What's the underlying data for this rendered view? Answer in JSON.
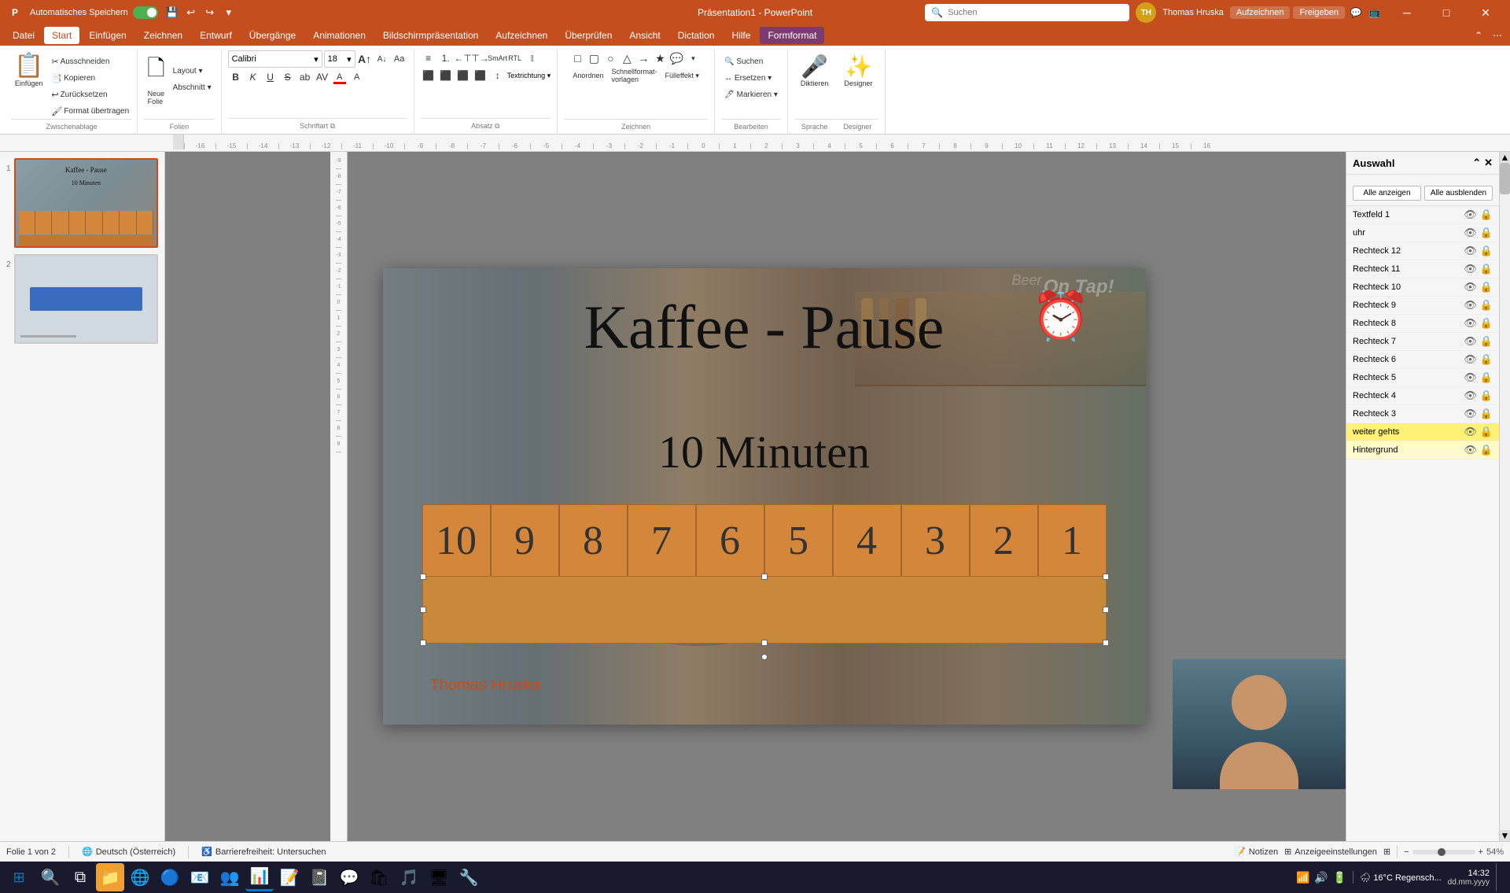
{
  "titlebar": {
    "autosave_label": "Automatisches Speichern",
    "app_name": "Präsentation1 - PowerPoint",
    "search_placeholder": "Suchen",
    "user_name": "Thomas Hruska",
    "user_initials": "TH",
    "save_icon": "💾",
    "undo_icon": "↩",
    "redo_icon": "↪",
    "record_label": "Aufzeichnen",
    "share_label": "Freigeben"
  },
  "menubar": {
    "items": [
      {
        "id": "datei",
        "label": "Datei"
      },
      {
        "id": "start",
        "label": "Start",
        "active": true
      },
      {
        "id": "einfugen",
        "label": "Einfügen"
      },
      {
        "id": "zeichnen",
        "label": "Zeichnen"
      },
      {
        "id": "entwurf",
        "label": "Entwurf"
      },
      {
        "id": "ubergange",
        "label": "Übergänge"
      },
      {
        "id": "animationen",
        "label": "Animationen"
      },
      {
        "id": "bildschirmprasentation",
        "label": "Bildschirmpräsentation"
      },
      {
        "id": "aufzeichnen",
        "label": "Aufzeichnen"
      },
      {
        "id": "uberprüfen",
        "label": "Überprüfen"
      },
      {
        "id": "ansicht",
        "label": "Ansicht"
      },
      {
        "id": "dictation",
        "label": "Dictation"
      },
      {
        "id": "hilfe",
        "label": "Hilfe"
      },
      {
        "id": "formformat",
        "label": "Formformat",
        "highlight": true
      }
    ]
  },
  "ribbon": {
    "groups": [
      {
        "id": "zwischenablage",
        "label": "Zwischenablage",
        "buttons": [
          {
            "id": "einfugen-btn",
            "icon": "📋",
            "label": "Einfügen"
          },
          {
            "id": "ausschneiden",
            "label": "✂ Ausschneiden"
          },
          {
            "id": "kopieren",
            "label": "📑 Kopieren"
          },
          {
            "id": "zurucksetzen",
            "label": "🔄 Zurücksetzen"
          },
          {
            "id": "format-ubertragen",
            "label": "🖌 Format übertragen"
          }
        ]
      },
      {
        "id": "folien",
        "label": "Folien",
        "buttons": [
          {
            "id": "neue-folie",
            "icon": "🗋",
            "label": "Neue\nFolie"
          },
          {
            "id": "layout",
            "label": "Layout ▾"
          },
          {
            "id": "abschnitt",
            "label": "Abschnitt ▾"
          }
        ]
      },
      {
        "id": "schriftart",
        "label": "Schriftart",
        "font_name": "Calibri",
        "font_size": "18",
        "buttons": [
          "B",
          "K",
          "U",
          "S",
          "ab",
          "A",
          "A"
        ]
      },
      {
        "id": "absatz",
        "label": "Absatz"
      },
      {
        "id": "zeichnen",
        "label": "Zeichnen"
      },
      {
        "id": "bearbeiten",
        "label": "Bearbeiten",
        "buttons": [
          {
            "id": "suchen",
            "label": "🔍 Suchen"
          },
          {
            "id": "ersetzen",
            "label": "🔁 Ersetzen"
          },
          {
            "id": "markieren",
            "label": "🖊 Markieren"
          }
        ]
      },
      {
        "id": "sprache",
        "label": "Sprache",
        "buttons": [
          {
            "id": "diktieren",
            "icon": "🎤",
            "label": "Diktieren"
          },
          {
            "id": "designer",
            "icon": "✨",
            "label": "Designer"
          }
        ]
      }
    ]
  },
  "slide1": {
    "title": "Kaffee - Pause",
    "subtitle": "10 Minuten",
    "author": "Thomas Hruska",
    "clock": "⏰",
    "countdown_numbers": [
      "10",
      "9",
      "8",
      "7",
      "6",
      "5",
      "4",
      "3",
      "2",
      "1"
    ]
  },
  "slide2": {
    "description": "Slide 2 thumbnail"
  },
  "right_panel": {
    "title": "Auswahl",
    "show_all": "Alle anzeigen",
    "hide_all": "Alle ausblenden",
    "layers": [
      {
        "id": "textfeld1",
        "name": "Textfeld 1",
        "visible": true,
        "locked": false
      },
      {
        "id": "uhr",
        "name": "uhr",
        "visible": true,
        "locked": false
      },
      {
        "id": "rechteck12",
        "name": "Rechteck 12",
        "visible": true,
        "locked": false
      },
      {
        "id": "rechteck11",
        "name": "Rechteck 11",
        "visible": true,
        "locked": false
      },
      {
        "id": "rechteck10",
        "name": "Rechteck 10",
        "visible": true,
        "locked": false
      },
      {
        "id": "rechteck9",
        "name": "Rechteck 9",
        "visible": true,
        "locked": false
      },
      {
        "id": "rechteck8",
        "name": "Rechteck 8",
        "visible": true,
        "locked": false
      },
      {
        "id": "rechteck7",
        "name": "Rechteck 7",
        "visible": true,
        "locked": false
      },
      {
        "id": "rechteck6",
        "name": "Rechteck 6",
        "visible": true,
        "locked": false
      },
      {
        "id": "rechteck5",
        "name": "Rechteck 5",
        "visible": true,
        "locked": false
      },
      {
        "id": "rechteck4",
        "name": "Rechteck 4",
        "visible": true,
        "locked": false
      },
      {
        "id": "rechteck3",
        "name": "Rechteck 3",
        "visible": true,
        "locked": false
      },
      {
        "id": "weiter_gehts",
        "name": "weiter gehts",
        "visible": true,
        "locked": false,
        "highlighted": true
      },
      {
        "id": "hintergrund",
        "name": "Hintergrund",
        "visible": true,
        "locked": false,
        "active": true
      }
    ]
  },
  "statusbar": {
    "folie": "Folie 1 von 2",
    "language": "Deutsch (Österreich)",
    "accessibility": "Barrierefreiheit: Untersuchen",
    "notizen": "Notizen",
    "anzeigeeinstellungen": "Anzeigeeinstellungen"
  },
  "taskbar": {
    "apps": [
      {
        "id": "windows",
        "icon": "⊞",
        "color": "#0078d4"
      },
      {
        "id": "search",
        "icon": "🔍"
      },
      {
        "id": "taskview",
        "icon": "⧉"
      },
      {
        "id": "edge",
        "icon": "🌐"
      },
      {
        "id": "explorer",
        "icon": "📁"
      },
      {
        "id": "chrome",
        "icon": "🔵"
      },
      {
        "id": "outlook",
        "icon": "📧"
      },
      {
        "id": "teams",
        "icon": "👥"
      },
      {
        "id": "powerpoint",
        "icon": "📊",
        "active": true
      },
      {
        "id": "word",
        "icon": "📝"
      },
      {
        "id": "store",
        "icon": "🛍"
      },
      {
        "id": "spotify",
        "icon": "🎵"
      },
      {
        "id": "settings",
        "icon": "⚙"
      }
    ],
    "tray": {
      "weather": "16°C Regensch...",
      "time": "14:32"
    }
  }
}
